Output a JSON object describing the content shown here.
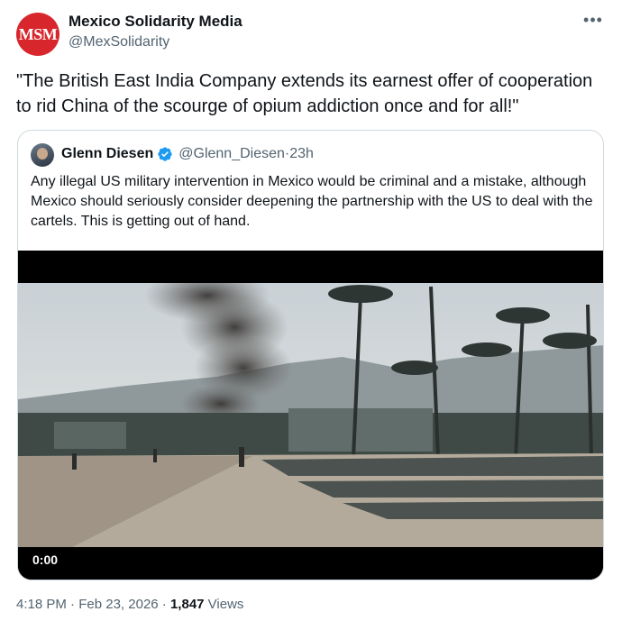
{
  "author": {
    "avatar_text": "MSM",
    "display_name": "Mexico Solidarity Media",
    "handle": "@MexSolidarity"
  },
  "more_icon": "more-dots-icon",
  "tweet_text": "\"The British East India Company extends its earnest offer of cooperation to rid China of the scourge of opium addiction once and for all!\"",
  "quote": {
    "display_name": "Glenn Diesen",
    "handle": "@Glenn_Diesen",
    "separator": " · ",
    "time": "23h",
    "verified_icon": "verified-badge-icon",
    "text": "Any illegal US military intervention in Mexico would be criminal and a mistake, although Mexico should seriously consider deepening the partnership with the US to deal with the cartels. This is getting out of hand.",
    "video": {
      "timestamp": "0:00"
    }
  },
  "footer": {
    "time": "4:18 PM",
    "sep1": " · ",
    "date": "Feb 23, 2026",
    "sep2": " · ",
    "views_count": "1,847",
    "views_label": " Views"
  },
  "colors": {
    "brand_red": "#d7262c",
    "verified_blue": "#1d9bf0",
    "muted": "#536471"
  }
}
